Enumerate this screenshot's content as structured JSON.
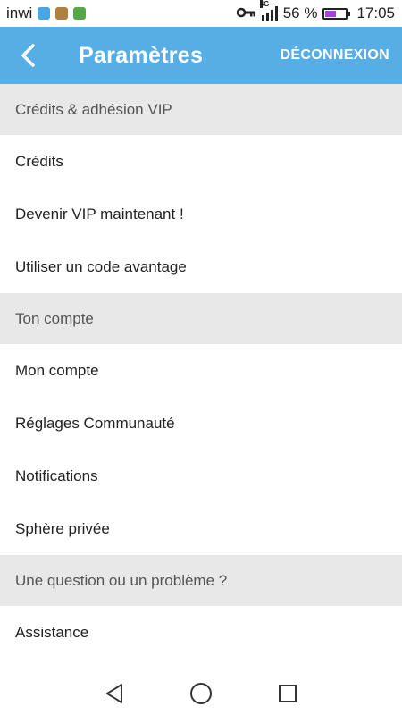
{
  "status_bar": {
    "carrier": "inwi",
    "network": "4G",
    "battery_percent": "56 %",
    "battery_level": 0.56,
    "time": "17:05",
    "app_icons": [
      "messenger-icon",
      "app-icon",
      "app-icon"
    ],
    "icons": [
      "key-icon",
      "signal-icon",
      "battery-icon"
    ]
  },
  "appbar": {
    "title": "Paramètres",
    "logout_label": "DÉCONNEXION",
    "color": "#56aee4"
  },
  "sections": [
    {
      "header": "Crédits & adhésion VIP",
      "items": [
        "Crédits",
        "Devenir VIP maintenant !",
        "Utiliser un code avantage"
      ]
    },
    {
      "header": "Ton compte",
      "items": [
        "Mon compte",
        "Réglages Communauté",
        "Notifications",
        "Sphère privée"
      ]
    },
    {
      "header": "Une question ou un problème ?",
      "items": [
        "Assistance"
      ]
    }
  ],
  "navbar": {
    "icons": [
      "back-triangle-icon",
      "home-circle-icon",
      "recents-square-icon"
    ]
  }
}
